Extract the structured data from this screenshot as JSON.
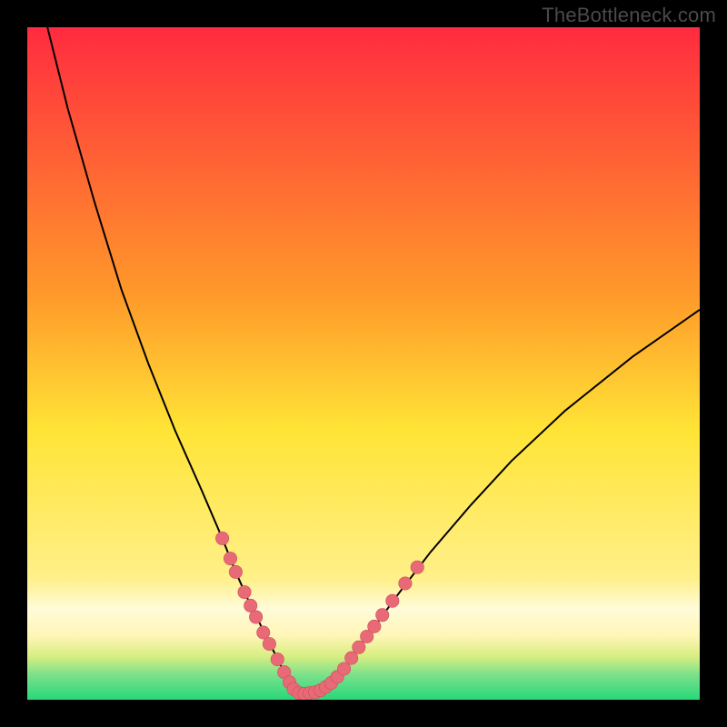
{
  "watermark": "TheBottleneck.com",
  "colors": {
    "frame": "#000000",
    "gradient_top": "#ff2b3f",
    "gradient_mid1": "#ffb030",
    "gradient_mid2": "#ffef3a",
    "gradient_band_light": "#fff9c8",
    "gradient_bottom": "#27e07f",
    "curve": "#000000",
    "marker_fill": "#e76a76",
    "marker_stroke": "#cc4f5c"
  },
  "chart_data": {
    "type": "line",
    "title": "",
    "xlabel": "",
    "ylabel": "",
    "xlim": [
      0,
      100
    ],
    "ylim": [
      0,
      100
    ],
    "grid": false,
    "legend": false,
    "series": [
      {
        "name": "bottleneck-curve",
        "x": [
          3,
          6,
          10,
          14,
          18,
          22,
          26,
          29,
          31,
          33,
          35,
          36.5,
          38,
          39.2,
          40,
          42,
          44,
          46,
          48,
          51,
          55,
          60,
          66,
          72,
          80,
          90,
          100
        ],
        "y": [
          100,
          88,
          74,
          61,
          50,
          40,
          31,
          24,
          19,
          14.5,
          10.5,
          7.5,
          4.5,
          2.3,
          1,
          1,
          1.5,
          3.2,
          6,
          10,
          15.5,
          22,
          29,
          35.5,
          43,
          51,
          58
        ]
      }
    ],
    "markers": [
      {
        "name": "dots-left",
        "points": [
          {
            "x": 29.0,
            "y": 24.0
          },
          {
            "x": 30.2,
            "y": 21.0
          },
          {
            "x": 31.0,
            "y": 19.0
          },
          {
            "x": 32.3,
            "y": 16.0
          },
          {
            "x": 33.2,
            "y": 14.0
          },
          {
            "x": 34.0,
            "y": 12.3
          },
          {
            "x": 35.1,
            "y": 10.0
          },
          {
            "x": 36.0,
            "y": 8.3
          },
          {
            "x": 37.2,
            "y": 6.0
          },
          {
            "x": 38.2,
            "y": 4.1
          },
          {
            "x": 39.0,
            "y": 2.6
          }
        ]
      },
      {
        "name": "dots-bottom",
        "points": [
          {
            "x": 39.6,
            "y": 1.6
          },
          {
            "x": 40.4,
            "y": 1.0
          },
          {
            "x": 41.2,
            "y": 0.9
          },
          {
            "x": 42.0,
            "y": 1.0
          },
          {
            "x": 42.8,
            "y": 1.1
          },
          {
            "x": 43.6,
            "y": 1.4
          },
          {
            "x": 44.4,
            "y": 1.9
          },
          {
            "x": 45.2,
            "y": 2.5
          }
        ]
      },
      {
        "name": "dots-right",
        "points": [
          {
            "x": 46.1,
            "y": 3.4
          },
          {
            "x": 47.1,
            "y": 4.6
          },
          {
            "x": 48.2,
            "y": 6.2
          },
          {
            "x": 49.3,
            "y": 7.8
          },
          {
            "x": 50.5,
            "y": 9.4
          },
          {
            "x": 51.6,
            "y": 10.9
          },
          {
            "x": 52.8,
            "y": 12.6
          },
          {
            "x": 54.3,
            "y": 14.7
          },
          {
            "x": 56.2,
            "y": 17.3
          },
          {
            "x": 58.0,
            "y": 19.7
          }
        ]
      }
    ],
    "gradient_stops": [
      {
        "offset": 0.0,
        "color": "#ff2b3f"
      },
      {
        "offset": 0.4,
        "color": "#ff9a2a"
      },
      {
        "offset": 0.6,
        "color": "#ffe436"
      },
      {
        "offset": 0.82,
        "color": "#fff08a"
      },
      {
        "offset": 0.865,
        "color": "#fffbd9"
      },
      {
        "offset": 0.905,
        "color": "#fff6b6"
      },
      {
        "offset": 0.935,
        "color": "#d9ee82"
      },
      {
        "offset": 0.965,
        "color": "#76e08a"
      },
      {
        "offset": 1.0,
        "color": "#27d879"
      }
    ]
  }
}
